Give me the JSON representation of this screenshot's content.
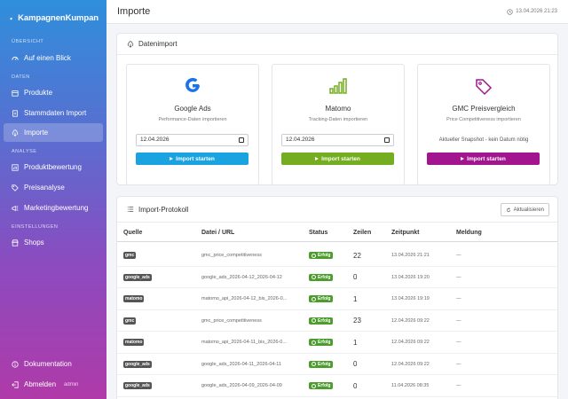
{
  "app": {
    "name": "KampagnenKumpan"
  },
  "sidebar": {
    "sections": {
      "overview": "Übersicht",
      "data": "Daten",
      "analysis": "Analyse",
      "settings": "Einstellungen"
    },
    "items": [
      {
        "label": "Auf einen Blick",
        "icon": "speedometer-icon"
      },
      {
        "label": "Produkte",
        "icon": "box-icon"
      },
      {
        "label": "Stammdaten Import",
        "icon": "document-icon"
      },
      {
        "label": "Importe",
        "icon": "cloud-download-icon"
      },
      {
        "label": "Produktbewertung",
        "icon": "chart-icon"
      },
      {
        "label": "Preisanalyse",
        "icon": "tag-icon"
      },
      {
        "label": "Marketingbewertung",
        "icon": "megaphone-icon"
      },
      {
        "label": "Shops",
        "icon": "shop-icon"
      }
    ],
    "bottom": {
      "docs": "Dokumentation",
      "logout": "Abmelden",
      "user": "admin"
    }
  },
  "header": {
    "title": "Importe",
    "datetime": "13.04.2026 21:23"
  },
  "datenimport": {
    "title": "Datenimport",
    "sources": [
      {
        "name": "Google Ads",
        "desc": "Performance-Daten importieren",
        "date": "12.04.2026",
        "button": "Import starten",
        "color": "#1aa3e0"
      },
      {
        "name": "Matomo",
        "desc": "Tracking-Daten importieren",
        "date": "12.04.2026",
        "button": "Import starten",
        "color": "#74ad20"
      },
      {
        "name": "GMC Preisvergleich",
        "desc": "Price Competitiveness importieren",
        "snapshot": "Aktueller Snapshot - kein Datum nötig",
        "button": "Import starten",
        "color": "#a3158e"
      }
    ]
  },
  "protokoll": {
    "title": "Import-Protokoll",
    "refresh": "Aktualisieren",
    "columns": [
      "Quelle",
      "Datei / URL",
      "Status",
      "Zeilen",
      "Zeitpunkt",
      "Meldung"
    ],
    "rows": [
      {
        "source": "gmc",
        "file": "gmc_price_competitiveness",
        "status": "Erfolg",
        "rows": "22",
        "time": "13.04.2026 21:21",
        "msg": "—"
      },
      {
        "source": "google_ads",
        "file": "google_ads_2026-04-12_2026-04-12",
        "status": "Erfolg",
        "rows": "0",
        "time": "13.04.2026 19:20",
        "msg": "—"
      },
      {
        "source": "matomo",
        "file": "matomo_api_2026-04-12_bis_2026-0...",
        "status": "Erfolg",
        "rows": "1",
        "time": "13.04.2026 19:19",
        "msg": "—"
      },
      {
        "source": "gmc",
        "file": "gmc_price_competitiveness",
        "status": "Erfolg",
        "rows": "23",
        "time": "12.04.2026 09:22",
        "msg": "—"
      },
      {
        "source": "matomo",
        "file": "matomo_api_2026-04-11_bis_2026-0...",
        "status": "Erfolg",
        "rows": "1",
        "time": "12.04.2026 09:22",
        "msg": "—"
      },
      {
        "source": "google_ads",
        "file": "google_ads_2026-04-11_2026-04-11",
        "status": "Erfolg",
        "rows": "0",
        "time": "12.04.2026 09:22",
        "msg": "—"
      },
      {
        "source": "google_ads",
        "file": "google_ads_2026-04-09_2026-04-09",
        "status": "Erfolg",
        "rows": "0",
        "time": "11.04.2026 08:35",
        "msg": "—"
      }
    ]
  }
}
